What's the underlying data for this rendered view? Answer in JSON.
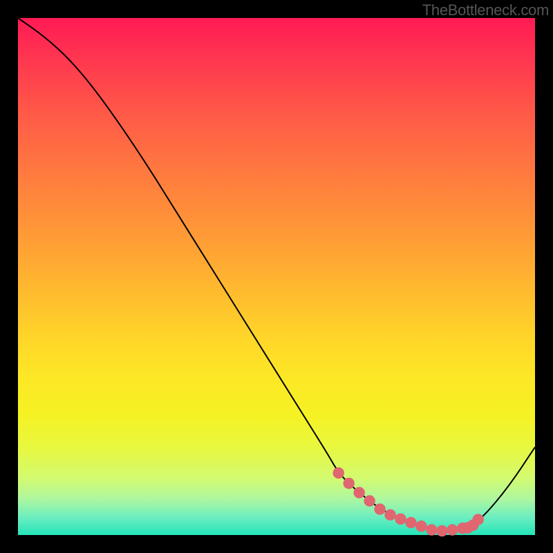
{
  "watermark": "TheBottleneck.com",
  "chart_data": {
    "type": "line",
    "title": "",
    "xlabel": "",
    "ylabel": "",
    "xlim": [
      0,
      100
    ],
    "ylim": [
      0,
      100
    ],
    "series": [
      {
        "name": "curve",
        "x": [
          0,
          5,
          10,
          15,
          20,
          25,
          30,
          35,
          40,
          45,
          50,
          55,
          60,
          62,
          65,
          70,
          75,
          80,
          83,
          87,
          90,
          95,
          100
        ],
        "y": [
          100,
          96.5,
          92,
          86,
          79,
          71.5,
          63.5,
          55.5,
          47.5,
          39.5,
          31.5,
          23.5,
          15.5,
          12,
          9,
          5,
          2.5,
          1,
          0.8,
          1.4,
          3.5,
          9.5,
          17
        ]
      },
      {
        "name": "highlight-dots",
        "x": [
          62,
          64,
          66,
          68,
          70,
          72,
          74,
          76,
          78,
          80,
          82,
          84,
          86,
          87,
          88,
          89
        ],
        "y": [
          12,
          10,
          8.2,
          6.6,
          5,
          3.9,
          3.1,
          2.4,
          1.7,
          1,
          0.8,
          1,
          1.3,
          1.4,
          1.9,
          3
        ]
      }
    ],
    "colors": {
      "curve": "#000000",
      "dots": "#e06670",
      "gradient_top": "#ff1a55",
      "gradient_bottom": "#24e4b9"
    }
  }
}
